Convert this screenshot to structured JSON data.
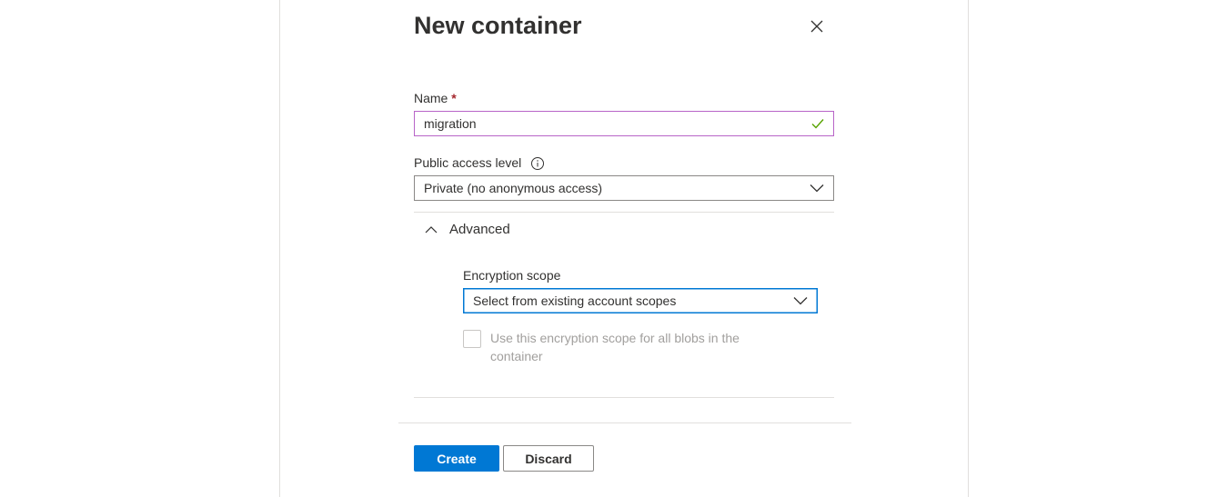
{
  "dialog": {
    "title": "New container",
    "close_icon": "close-icon"
  },
  "name_field": {
    "label": "Name",
    "required_marker": "*",
    "value": "migration",
    "valid_icon": "checkmark-icon"
  },
  "public_access": {
    "label": "Public access level",
    "info_icon": "info-icon",
    "selected": "Private (no anonymous access)"
  },
  "advanced": {
    "label": "Advanced",
    "expanded": true,
    "encryption_scope": {
      "label": "Encryption scope",
      "placeholder": "Select from existing account scopes"
    },
    "checkbox": {
      "label": "Use this encryption scope for all blobs in the container",
      "checked": false,
      "disabled": true
    }
  },
  "footer": {
    "create_label": "Create",
    "discard_label": "Discard"
  },
  "colors": {
    "primary": "#0078d4",
    "required": "#a4262c",
    "valid": "#57a300",
    "name_border": "#b864c8"
  }
}
